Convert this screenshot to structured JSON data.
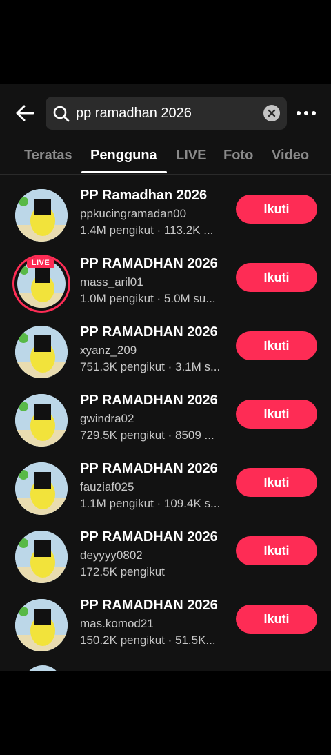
{
  "search": {
    "query": "pp ramadhan 2026",
    "placeholder": ""
  },
  "icons": {
    "back": "back-arrow-icon",
    "search": "search-icon",
    "clear": "clear-icon",
    "more": "more-options-icon"
  },
  "colors": {
    "accent": "#fe2c55",
    "background": "#121212"
  },
  "tabs": [
    {
      "label": "Teratas"
    },
    {
      "label": "Pengguna"
    },
    {
      "label": "LIVE"
    },
    {
      "label": "Foto"
    },
    {
      "label": "Video"
    }
  ],
  "active_tab": "Pengguna",
  "users": [
    {
      "title": "PP Ramadhan 2026",
      "handle": "ppkucingramadan00",
      "meta": "1.4M pengikut · 113.2K ...",
      "follow": "Ikuti",
      "live": false
    },
    {
      "title": "PP RAMADHAN 2026",
      "handle": "mass_aril01",
      "meta": "1.0M pengikut · 5.0M su...",
      "follow": "Ikuti",
      "live": true,
      "live_label": "LIVE"
    },
    {
      "title": "PP RAMADHAN 2026",
      "handle": "xyanz_209",
      "meta": "751.3K pengikut · 3.1M s...",
      "follow": "Ikuti",
      "live": false
    },
    {
      "title": "PP RAMADHAN 2026",
      "handle": "gwindra02",
      "meta": "729.5K pengikut · 8509 ...",
      "follow": "Ikuti",
      "live": false
    },
    {
      "title": "PP RAMADHAN 2026",
      "handle": "fauziaf025",
      "meta": "1.1M pengikut · 109.4K s...",
      "follow": "Ikuti",
      "live": false
    },
    {
      "title": "PP RAMADHAN 2026",
      "handle": "deyyyy0802",
      "meta": "172.5K pengikut",
      "follow": "Ikuti",
      "live": false
    },
    {
      "title": "PP RAMADHAN 2026",
      "handle": "mas.komod21",
      "meta": "150.2K pengikut · 51.5K...",
      "follow": "Ikuti",
      "live": false
    }
  ]
}
